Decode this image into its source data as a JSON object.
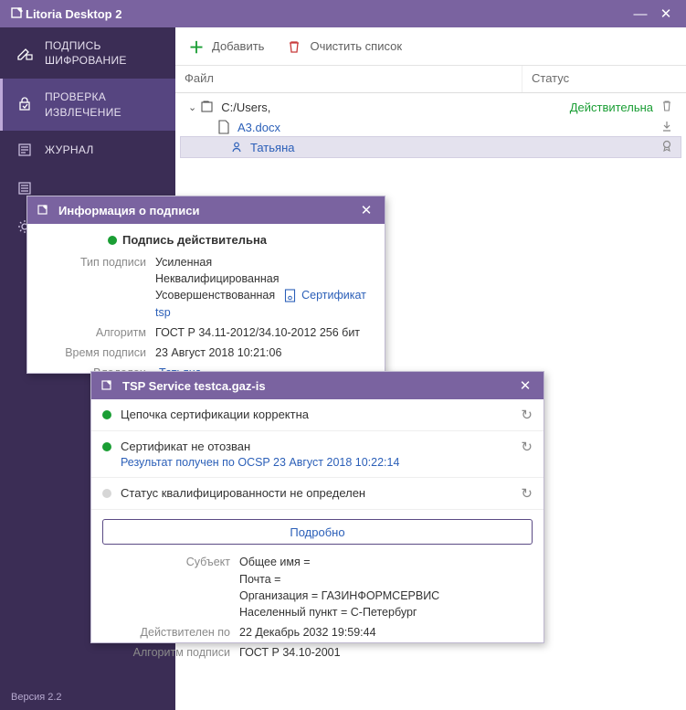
{
  "app": {
    "title": "Litoria Desktop 2",
    "version": "Версия 2.2"
  },
  "sidebar": {
    "items": [
      {
        "label": "ПОДПИСЬ\nШИФРОВАНИЕ"
      },
      {
        "label": "ПРОВЕРКА\nИЗВЛЕЧЕНИЕ",
        "active": true
      },
      {
        "label": "ЖУРНАЛ"
      },
      {
        "label": ""
      },
      {
        "label": ""
      }
    ]
  },
  "toolbar": {
    "add": "Добавить",
    "clear": "Очистить список"
  },
  "list": {
    "col1": "Файл",
    "col2": "Статус",
    "root": "C:/Users,",
    "file": "A3.docx",
    "signer": "Татьяна",
    "status": "Действительна"
  },
  "sigwin": {
    "title": "Информация о подписи",
    "badge": "Подпись действительна",
    "rows": {
      "type_k": "Тип подписи",
      "type_v": "Усиленная\nНеквалифицированная\nУсовершенствованная",
      "cert_link": "Сертификат tsp",
      "alg_k": "Алгоритм",
      "alg_v": "ГОСТ Р 34.11-2012/34.10-2012 256 бит",
      "time_k": "Время подписи",
      "time_v": "23 Август 2018 10:21:06",
      "owner_k": "Владелец",
      "owner_v": "Татьяна"
    }
  },
  "tspwin": {
    "title": "TSP Service testca.gaz-is",
    "checks": [
      {
        "led": "#1a9e34",
        "text": "Цепочка сертификации корректна"
      },
      {
        "led": "#1a9e34",
        "text": "Сертификат не отозван",
        "sub": "Результат получен по OCSP 23 Август 2018 10:22:14"
      },
      {
        "led": "#d6d6d6",
        "text": "Статус квалифицированности не определен"
      }
    ],
    "detail": "Подробно",
    "subject_k": "Субъект",
    "subject_v": "Общее имя =\nПочта =\nОрганизация = ГАЗИНФОРМСЕРВИС\nНаселенный пункт = С-Петербург",
    "valid_k": "Действителен по",
    "valid_v": "22 Декабрь 2032 19:59:44",
    "algo_k": "Алгоритм подписи",
    "algo_v": "ГОСТ Р 34.10-2001"
  }
}
